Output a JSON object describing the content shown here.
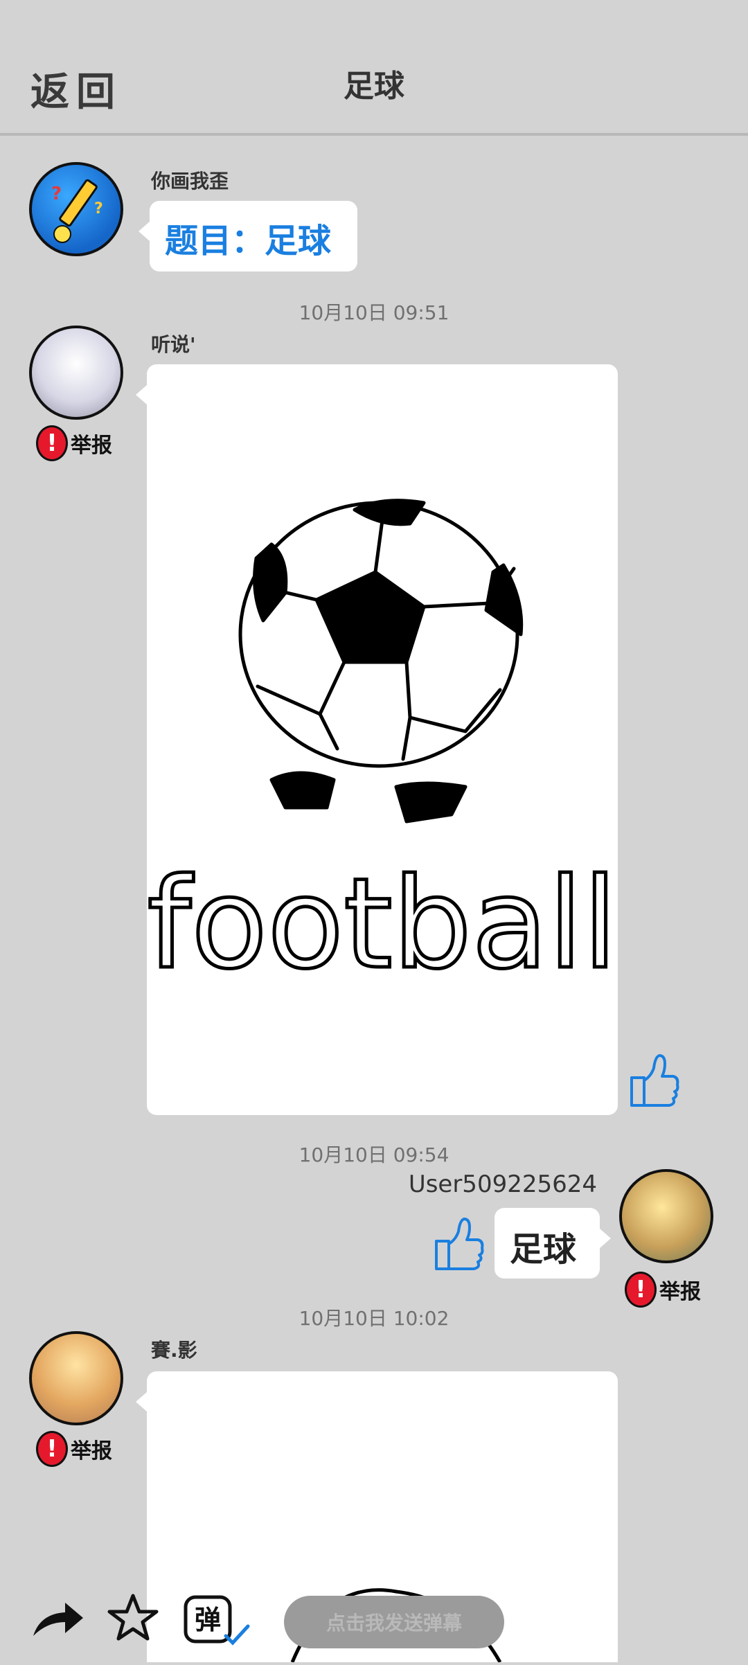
{
  "header": {
    "back_label": "返回",
    "title": "足球"
  },
  "messages": [
    {
      "sender": "你画我歪",
      "text": "题目：足球"
    },
    {
      "time": "10月10日  09:51",
      "sender": "听说'",
      "drawing_caption": "football",
      "report_label": "举报"
    },
    {
      "time": "10月10日  09:54",
      "sender": "User509225624",
      "text": "足球",
      "report_label": "举报"
    },
    {
      "time": "10月10日  10:02",
      "sender": "賽.影",
      "report_label": "举报"
    }
  ],
  "bottom_bar": {
    "share_icon": "share-arrow-icon",
    "favorite_icon": "star-icon",
    "danmaku_icon": "danmaku-toggle-icon",
    "danmaku_icon_char": "弹",
    "danmaku_placeholder": "点击我发送弹幕"
  },
  "colors": {
    "accent_blue": "#1a7fe0",
    "report_red": "#e6192c",
    "background": "#d3d3d3"
  }
}
